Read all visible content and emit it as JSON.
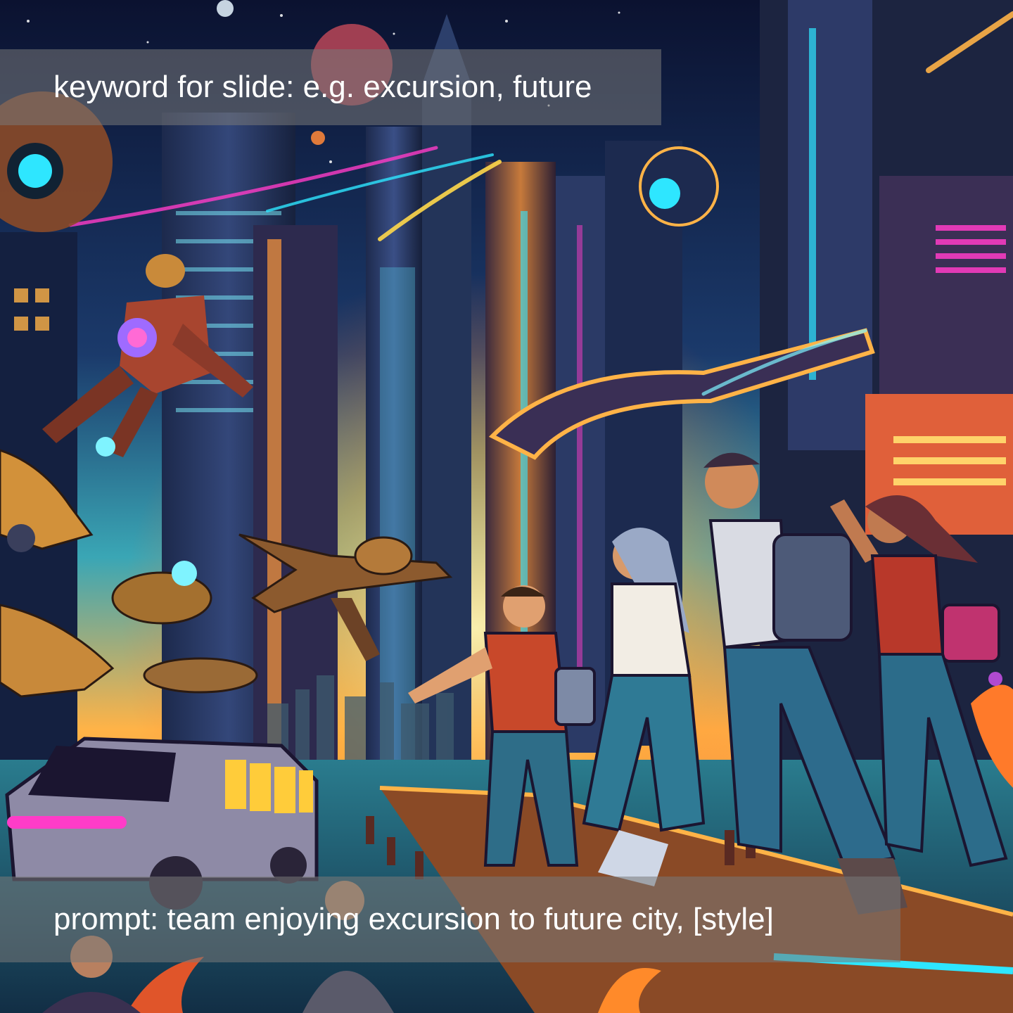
{
  "slide": {
    "keyword_caption": "keyword for slide: e.g. excursion, future",
    "prompt_caption": "prompt: team enjoying excursion to future city, [style]"
  },
  "colors": {
    "caption_background": "#787878",
    "caption_text": "#ffffff",
    "sky_top": "#0b1230",
    "horizon_glow": "#ffb347",
    "neon_cyan": "#2ee6ff",
    "neon_magenta": "#ff3cc8"
  },
  "illustration": {
    "subject": "group-of-friends-viewing-futuristic-city",
    "elements": [
      "skyscraper-towers",
      "flying-ships",
      "robot-figure",
      "hover-van",
      "walking-people",
      "glowing-horizon"
    ]
  }
}
